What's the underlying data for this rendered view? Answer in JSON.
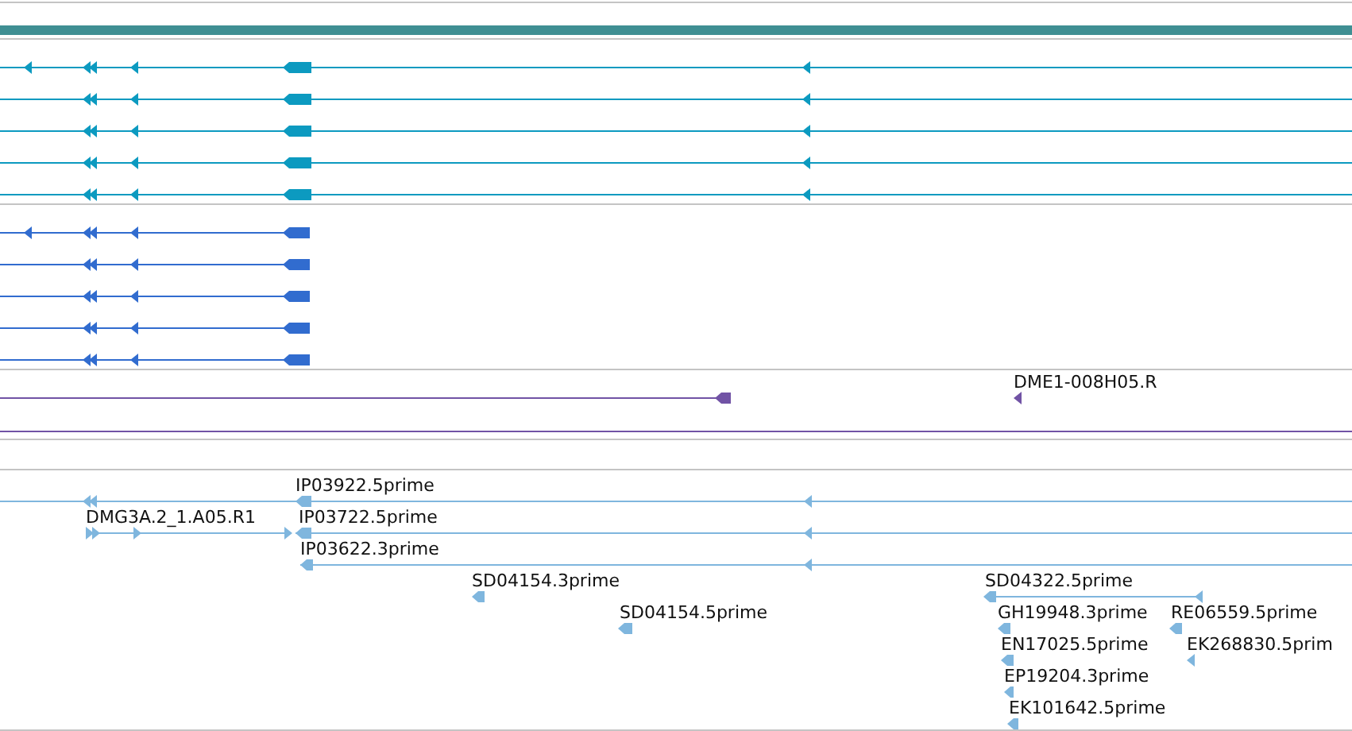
{
  "tracks": [
    {
      "kind": "bar",
      "color": "#3f8f93"
    },
    {
      "kind": "transcripts",
      "color": "#0c9ac0"
    },
    {
      "kind": "transcripts",
      "color": "#316ccf"
    },
    {
      "kind": "labeled",
      "color": "#7153a5",
      "features": [
        {
          "label": "DME1-008H05.R"
        }
      ]
    },
    {
      "kind": "labeled",
      "color": "#7fb6de",
      "features": [
        {
          "label": "IP03922.5prime"
        },
        {
          "label": "DMG3A.2_1.A05.R1"
        },
        {
          "label": "IP03722.5prime"
        },
        {
          "label": "IP03622.3prime"
        },
        {
          "label": "SD04154.3prime"
        },
        {
          "label": "SD04154.5prime"
        },
        {
          "label": "SD04322.5prime"
        },
        {
          "label": "GH19948.3prime"
        },
        {
          "label": "RE06559.5prime"
        },
        {
          "label": "EN17025.5prime"
        },
        {
          "label": "EK268830.5prim"
        },
        {
          "label": "EP19204.3prime"
        },
        {
          "label": "EK101642.5prime"
        }
      ]
    }
  ]
}
